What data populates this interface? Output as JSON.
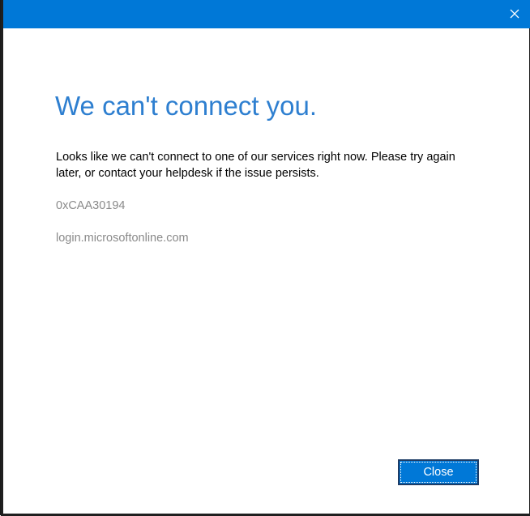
{
  "dialog": {
    "heading": "We can't connect you.",
    "message": "Looks like we can't connect to one of our services right now. Please try again later, or contact your helpdesk if the issue persists.",
    "error_code": "0xCAA30194",
    "host": "login.microsoftonline.com",
    "close_button_label": "Close"
  },
  "titlebar": {
    "close_icon": "close-icon"
  },
  "colors": {
    "titlebar": "#0078d7",
    "heading": "#2e7fd0",
    "secondary_text": "#8a8a8a",
    "button": "#0078d7"
  }
}
